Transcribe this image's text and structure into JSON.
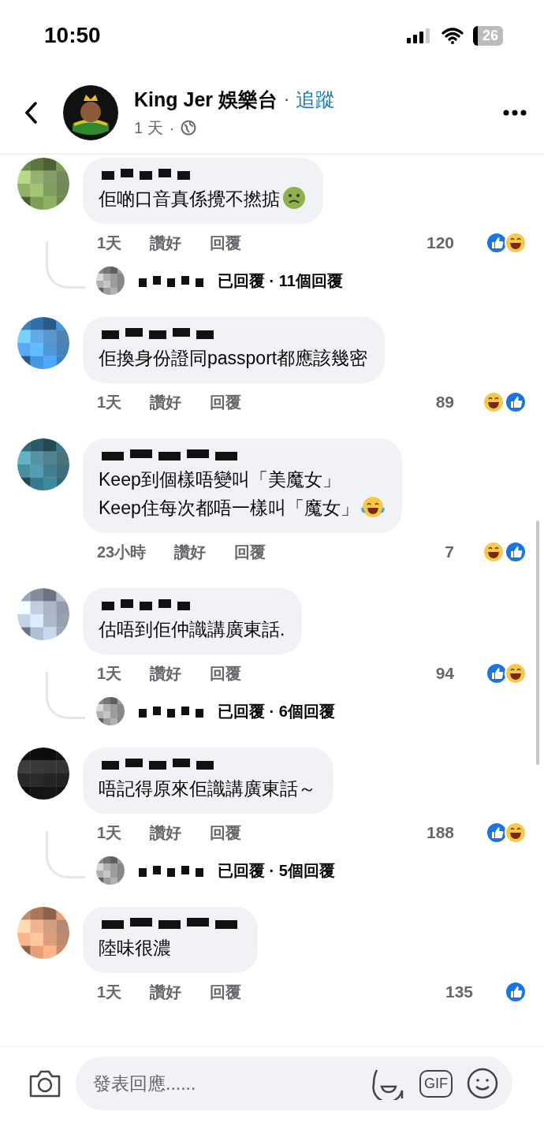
{
  "status_bar": {
    "time": "10:50",
    "battery": "26"
  },
  "header": {
    "page_name": "King Jer 娛樂台",
    "separator": "·",
    "follow": "追蹤",
    "time": "1 天",
    "time_separator": "·"
  },
  "comments": [
    {
      "text": "佢啲口音真係攪不撚掂",
      "emoji": {
        "kind": "nauseated"
      },
      "time": "1天",
      "like": "讚好",
      "reply": "回覆",
      "count": "120",
      "reactions": [
        {
          "kind": "like"
        },
        {
          "kind": "haha"
        }
      ],
      "replies": "已回覆 · 11個回覆"
    },
    {
      "text": "佢換身份證同passport都應該幾密",
      "time": "1天",
      "like": "讚好",
      "reply": "回覆",
      "count": "89",
      "reactions": [
        {
          "kind": "haha"
        },
        {
          "kind": "like"
        }
      ]
    },
    {
      "text": "Keep到個樣唔變叫「美魔女」\nKeep住每次都唔一樣叫「魔女」",
      "emoji": {
        "kind": "laughing"
      },
      "time": "23小時",
      "like": "讚好",
      "reply": "回覆",
      "count": "7",
      "reactions": [
        {
          "kind": "haha"
        },
        {
          "kind": "like"
        }
      ]
    },
    {
      "text": "估唔到佢仲識講廣東話.",
      "time": "1天",
      "like": "讚好",
      "reply": "回覆",
      "count": "94",
      "reactions": [
        {
          "kind": "like"
        },
        {
          "kind": "haha"
        }
      ],
      "replies": "已回覆 · 6個回覆"
    },
    {
      "text": "唔記得原來佢識講廣東話～",
      "time": "1天",
      "like": "讚好",
      "reply": "回覆",
      "count": "188",
      "reactions": [
        {
          "kind": "like"
        },
        {
          "kind": "haha"
        }
      ],
      "replies": "已回覆 · 5個回覆"
    },
    {
      "text": "陸味很濃",
      "time": "1天",
      "like": "讚好",
      "reply": "回覆",
      "count": "135",
      "reactions": [
        {
          "kind": "like"
        }
      ]
    }
  ],
  "composer": {
    "placeholder": "發表回應......",
    "gif_label": "GIF"
  }
}
